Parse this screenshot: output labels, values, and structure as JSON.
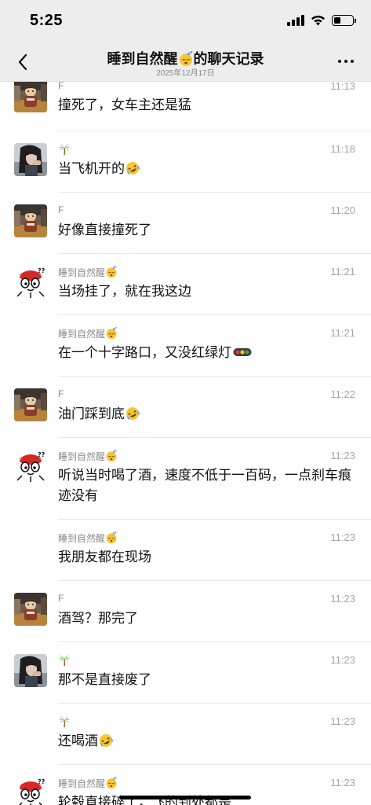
{
  "status_bar": {
    "time": "5:25"
  },
  "header": {
    "title": "睡到自然醒",
    "title_suffix": "的聊天记录",
    "subtitle": "2025年12月17日"
  },
  "icons": {
    "back": "chevron-left-icon",
    "more": "more-dots-icon",
    "sleep_emoji": "sleeping-face-emoji",
    "laugh_emoji": "rolling-laughing-emoji",
    "palm_emoji": "palm-tree-emoji",
    "traffic_light_emoji": "traffic-light-emoji"
  },
  "messages": [
    {
      "sender": "F",
      "time": "11:13",
      "text": "撞死了，女车主还是猛"
    },
    {
      "sender": "",
      "time": "11:18",
      "text": "当飞机开的"
    },
    {
      "sender": "F",
      "time": "11:20",
      "text": "好像直接撞死了"
    },
    {
      "sender": "睡到自然醒",
      "time": "11:21",
      "text": "当场挂了，就在我这边"
    },
    {
      "sender": "睡到自然醒",
      "time": "11:21",
      "text": "在一个十字路口，又没红绿灯"
    },
    {
      "sender": "F",
      "time": "11:22",
      "text": "油门踩到底"
    },
    {
      "sender": "睡到自然醒",
      "time": "11:23",
      "text": "听说当时喝了酒，速度不低于一百码，一点刹车痕迹没有"
    },
    {
      "sender": "睡到自然醒",
      "time": "11:23",
      "text": "我朋友都在现场"
    },
    {
      "sender": "F",
      "time": "11:23",
      "text": "酒驾？那完了"
    },
    {
      "sender": "",
      "time": "11:23",
      "text": "那不是直接废了"
    },
    {
      "sender": "",
      "time": "11:23",
      "text": "还喝酒"
    },
    {
      "sender": "睡到自然醒",
      "time": "11:23",
      "text": "轮毂直接碎了，飞的到处都是"
    }
  ]
}
